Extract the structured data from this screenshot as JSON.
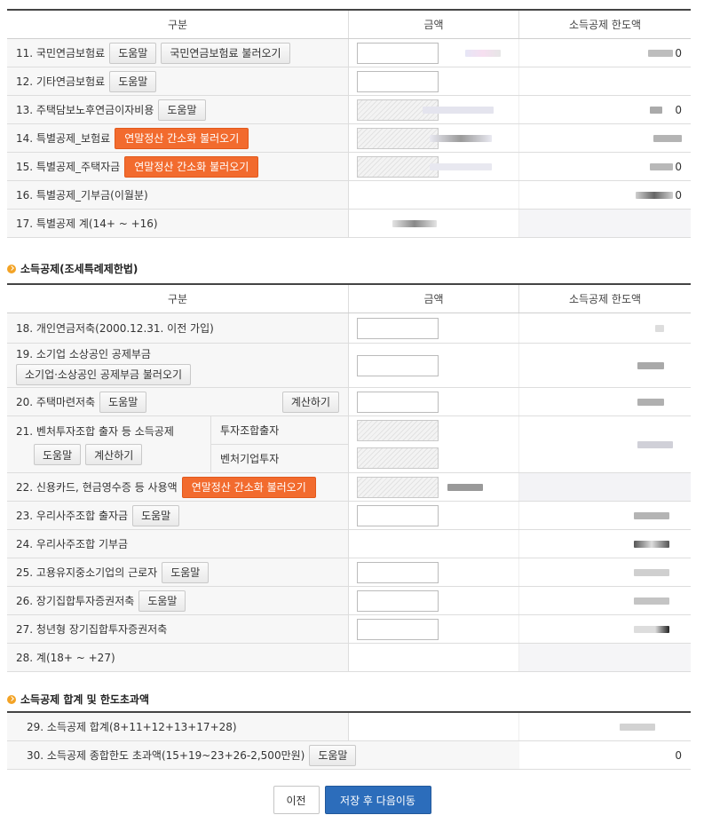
{
  "colors": {
    "orange": "#f26b2e",
    "blue": "#2c6dbb",
    "bullet": "#f3a325"
  },
  "table1": {
    "headers": [
      "구분",
      "금액",
      "소득공제 한도액"
    ],
    "rows": [
      {
        "label": "11. 국민연금보험료",
        "help": "도움말",
        "load": "국민연금보험료 불러오기",
        "limit": "0"
      },
      {
        "label": "12. 기타연금보험료",
        "help": "도움말"
      },
      {
        "label": "13. 주택담보노후연금이자비용",
        "help": "도움말",
        "limit": "0"
      },
      {
        "label": "14. 특별공제_보험료",
        "orange": "연말정산 간소화 불러오기"
      },
      {
        "label": "15. 특별공제_주택자금",
        "orange": "연말정산 간소화 불러오기",
        "limit": "0"
      },
      {
        "label": "16. 특별공제_기부금(이월분)",
        "limit": "0"
      },
      {
        "label": "17. 특별공제 계(14+ ~ +16)"
      }
    ]
  },
  "section2": {
    "title": "소득공제(조세특례제한법)"
  },
  "table2": {
    "headers": [
      "구분",
      "금액",
      "소득공제 한도액"
    ],
    "row18": "18. 개인연금저축(2000.12.31. 이전 가입)",
    "row19": {
      "label": "19. 소기업 소상공인 공제부금",
      "load": "소기업·소상공인 공제부금 불러오기"
    },
    "row20": {
      "label": "20. 주택마련저축",
      "help": "도움말",
      "calc": "계산하기"
    },
    "row21": {
      "label": "21. 벤처투자조합 출자 등 소득공제",
      "help": "도움말",
      "calc": "계산하기",
      "sub1": "투자조합출자",
      "sub2": "벤처기업투자"
    },
    "row22": {
      "label": "22. 신용카드, 현금영수증 등 사용액",
      "orange": "연말정산 간소화 불러오기"
    },
    "row23": {
      "label": "23. 우리사주조합 출자금",
      "help": "도움말"
    },
    "row24": "24. 우리사주조합 기부금",
    "row25": {
      "label": "25. 고용유지중소기업의 근로자",
      "help": "도움말"
    },
    "row26": {
      "label": "26. 장기집합투자증권저축",
      "help": "도움말"
    },
    "row27": "27. 청년형 장기집합투자증권저축",
    "row28": "28. 계(18+ ~ +27)"
  },
  "section3": {
    "title": "소득공제 합계 및 한도초과액"
  },
  "table3": {
    "row29": "29. 소득공제 합계(8+11+12+13+17+28)",
    "row30": {
      "label": "30. 소득공제 종합한도 초과액(15+19~23+26-2,500만원)",
      "help": "도움말",
      "value": "0"
    }
  },
  "footer": {
    "prev": "이전",
    "next": "저장 후 다음이동"
  }
}
